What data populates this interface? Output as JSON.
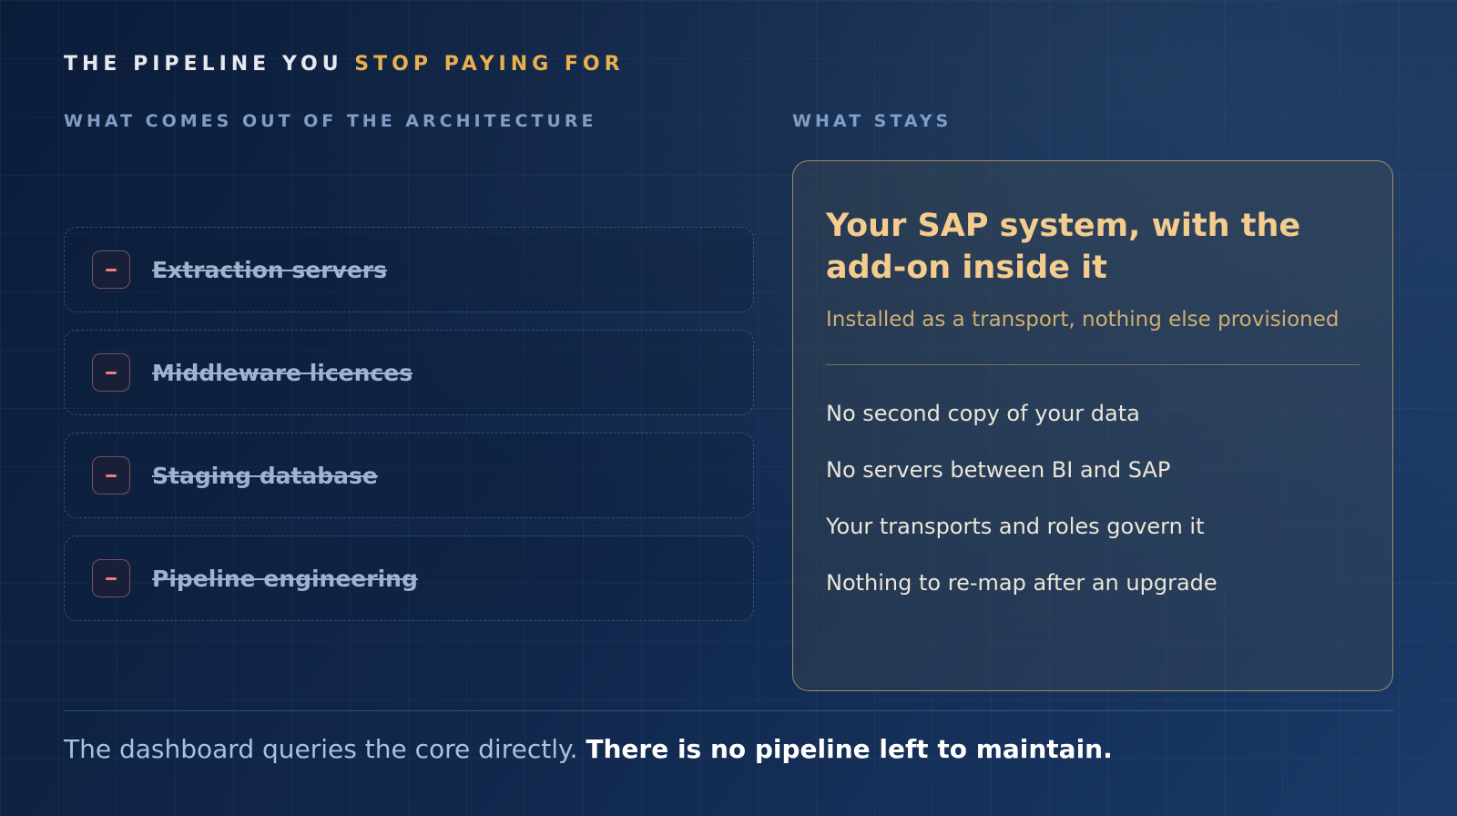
{
  "eyebrow": {
    "lead": "THE PIPELINE YOU",
    "accent": "STOP PAYING FOR"
  },
  "left_column": {
    "heading": "WHAT COMES OUT OF THE ARCHITECTURE",
    "items": [
      {
        "label": "Extraction servers"
      },
      {
        "label": "Middleware licences"
      },
      {
        "label": "Staging database"
      },
      {
        "label": "Pipeline engineering"
      }
    ]
  },
  "right_column": {
    "heading": "WHAT STAYS",
    "card": {
      "title": "Your SAP system, with the add-on inside it",
      "subtitle": "Installed as a transport, nothing else provisioned",
      "items": [
        {
          "label": "No second copy of your data"
        },
        {
          "label": "No servers between BI and SAP"
        },
        {
          "label": "Your transports and roles govern it"
        },
        {
          "label": "Nothing to re-map after an upgrade"
        }
      ]
    }
  },
  "footer": {
    "plain": "The dashboard queries the core directly.",
    "strong": "There is no pipeline left to maintain."
  },
  "colors": {
    "accent_gold": "#e9b04e",
    "removed_marker": "#f07a86",
    "background": "#0c1d3a"
  },
  "icons": {
    "removed_marker": "minus-icon"
  }
}
